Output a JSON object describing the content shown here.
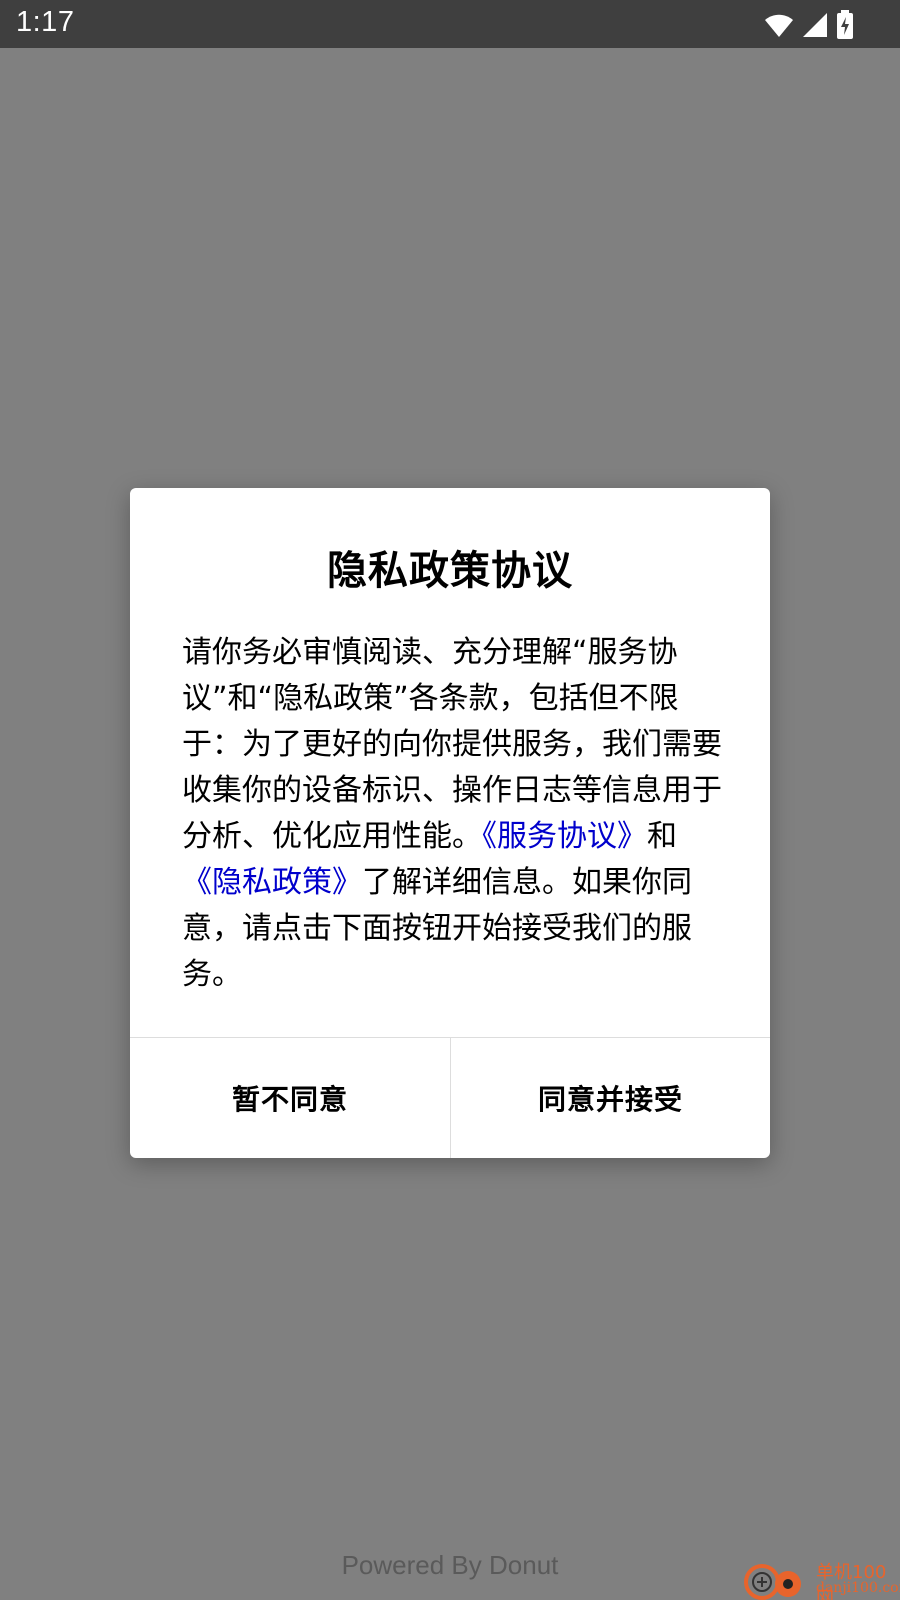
{
  "status_bar": {
    "time": "1:17",
    "icons": [
      "wifi-icon",
      "cell-signal-icon",
      "battery-charging-icon"
    ]
  },
  "dialog": {
    "title": "隐私政策协议",
    "body_part1": "请你务必审慎阅读、充分理解“服务协议”和“隐私政策”各条款，包括但不限于：为了更好的向你提供服务，我们需要收集你的设备标识、操作日志等信息用于分析、优化应用性能。",
    "service_link": "《服务协议》",
    "body_and": "和",
    "privacy_link": "《隐私政策》",
    "body_part2": "了解详细信息。如果你同意，请点击下面按钮开始接受我们的服务。",
    "decline_label": "暂不同意",
    "accept_label": "同意并接受"
  },
  "footer": {
    "powered_by": "Powered By Donut"
  },
  "watermark": {
    "site_cn": "单机100网",
    "site_en": "danji100.com"
  },
  "colors": {
    "overlay": "#808080",
    "status_bar": "#3f3f3f",
    "link": "#0000cc",
    "watermark_accent": "#e8642c"
  }
}
